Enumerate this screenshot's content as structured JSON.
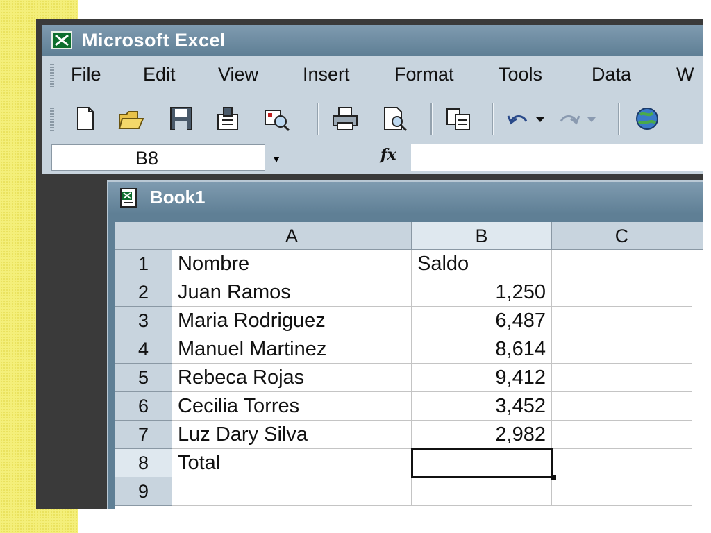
{
  "app": {
    "title": "Microsoft  Excel"
  },
  "menu": {
    "items": [
      "File",
      "Edit",
      "View",
      "Insert",
      "Format",
      "Tools",
      "Data",
      "W"
    ]
  },
  "toolbar": {
    "icons": [
      "new-document-icon",
      "open-folder-icon",
      "save-icon",
      "permission-icon",
      "research-icon",
      "print-icon",
      "print-preview-icon",
      "copy-icon",
      "undo-icon",
      "redo-icon",
      "web-globe-icon"
    ]
  },
  "formula_bar": {
    "name_box": "B8",
    "fx_label": "fx",
    "formula": ""
  },
  "workbook": {
    "title": "Book1",
    "columns": [
      "A",
      "B",
      "C"
    ],
    "rows": [
      {
        "num": "1",
        "a": "Nombre",
        "b": "Saldo"
      },
      {
        "num": "2",
        "a": "Juan Ramos",
        "b": "1,250"
      },
      {
        "num": "3",
        "a": "Maria Rodriguez",
        "b": "6,487"
      },
      {
        "num": "4",
        "a": "Manuel Martinez",
        "b": "8,614"
      },
      {
        "num": "5",
        "a": "Rebeca Rojas",
        "b": "9,412"
      },
      {
        "num": "6",
        "a": "Cecilia Torres",
        "b": "3,452"
      },
      {
        "num": "7",
        "a": "Luz Dary Silva",
        "b": "2,982"
      },
      {
        "num": "8",
        "a": "Total",
        "b": ""
      },
      {
        "num": "9",
        "a": "",
        "b": ""
      }
    ],
    "active_cell": "B8"
  },
  "colors": {
    "title_bar": "#6a889d",
    "chrome": "#c8d4de",
    "side_strip": "#f4ef7a"
  }
}
